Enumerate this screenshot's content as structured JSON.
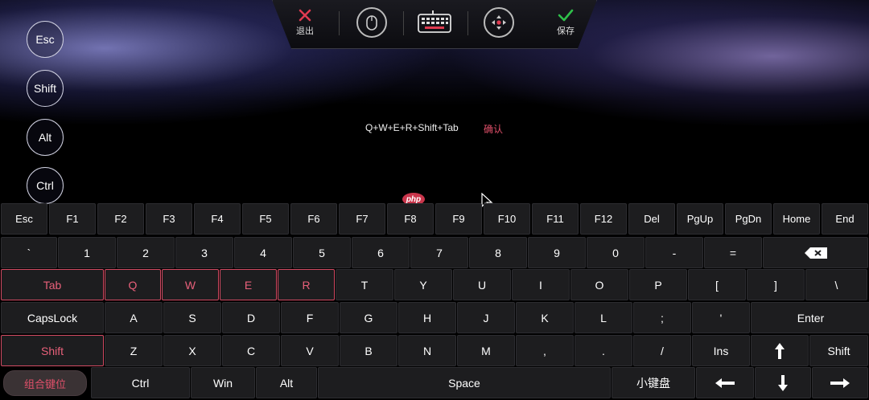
{
  "toolbar": {
    "exit_label": "退出",
    "save_label": "保存"
  },
  "side_keys": [
    "Esc",
    "Shift",
    "Alt",
    "Ctrl"
  ],
  "combo": {
    "text": "Q+W+E+R+Shift+Tab",
    "confirm_label": "确认"
  },
  "watermark": "php",
  "keyboard": {
    "row1": [
      "Esc",
      "F1",
      "F2",
      "F3",
      "F4",
      "F5",
      "F6",
      "F7",
      "F8",
      "F9",
      "F10",
      "F11",
      "F12",
      "Del",
      "PgUp",
      "PgDn",
      "Home",
      "End"
    ],
    "row2": [
      "`",
      "1",
      "2",
      "3",
      "4",
      "5",
      "6",
      "7",
      "8",
      "9",
      "0",
      "-",
      "="
    ],
    "row3": [
      "Tab",
      "Q",
      "W",
      "E",
      "R",
      "T",
      "Y",
      "U",
      "I",
      "O",
      "P",
      "[",
      "]",
      "\\"
    ],
    "row4": [
      "CapsLock",
      "A",
      "S",
      "D",
      "F",
      "G",
      "H",
      "J",
      "K",
      "L",
      ";",
      "'",
      "Enter"
    ],
    "row5": [
      "Shift",
      "Z",
      "X",
      "C",
      "V",
      "B",
      "N",
      "M",
      ",",
      ".",
      "/",
      "Ins",
      "Shift"
    ],
    "row6": [
      "组合键位",
      "Ctrl",
      "Win",
      "Alt",
      "Space",
      "小键盘"
    ],
    "selected_keys": [
      "Tab",
      "Q",
      "W",
      "E",
      "R",
      "Shift"
    ]
  },
  "colors": {
    "accent": "#d24a62",
    "key_bg": "#1d1d1f",
    "background": "#000000"
  }
}
